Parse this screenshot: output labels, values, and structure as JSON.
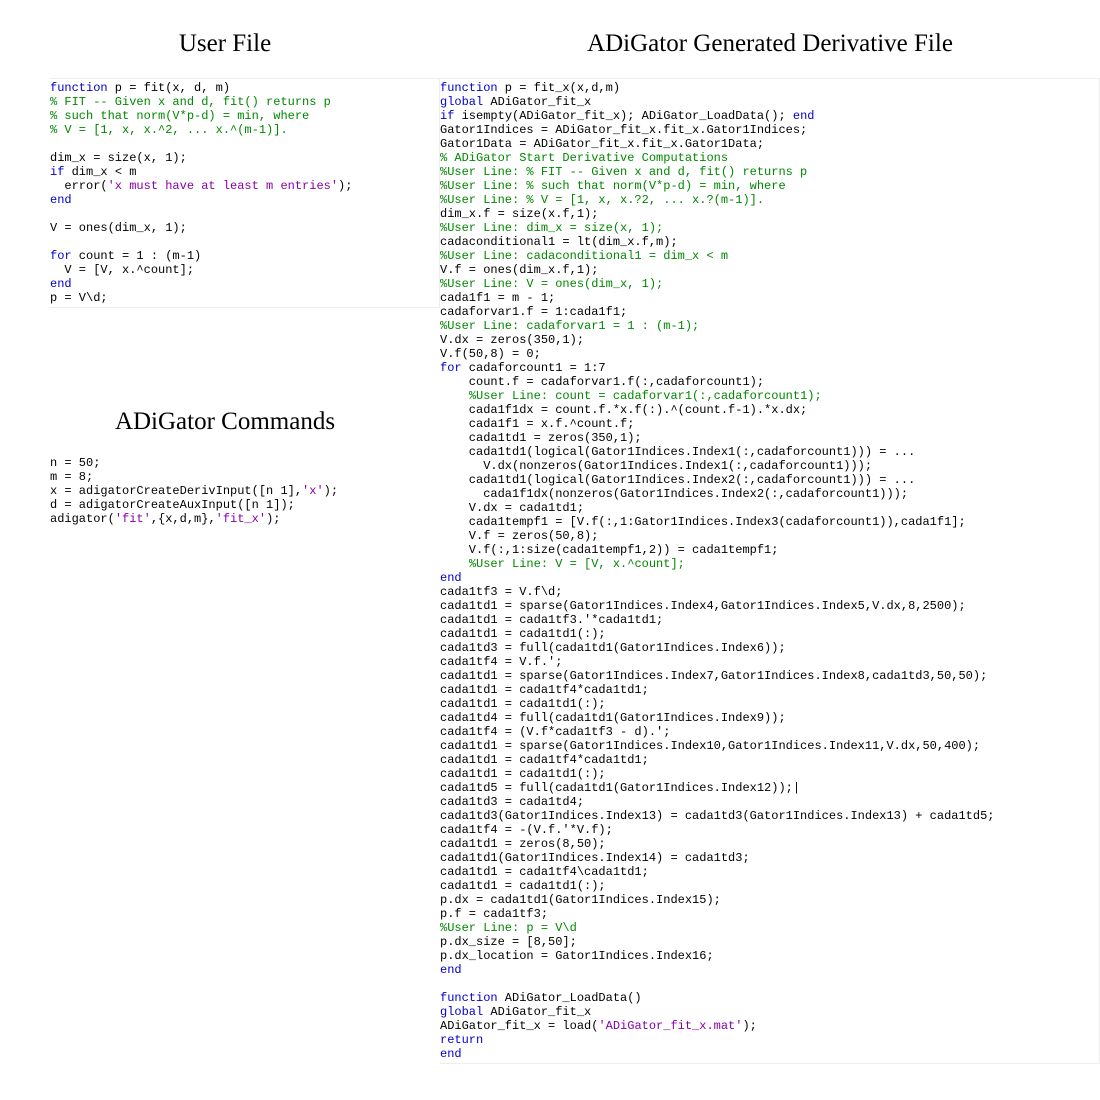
{
  "left": {
    "heading1": "User File",
    "heading2": "ADiGator Commands",
    "userFile": [
      {
        "cls": "kw",
        "t": "function",
        "post": " p = fit(x, d, m)"
      },
      {
        "cls": "cm",
        "t": "% FIT -- Given x and d, fit() returns p"
      },
      {
        "cls": "cm",
        "t": "% such that norm(V*p-d) = min, where"
      },
      {
        "cls": "cm",
        "t": "% V = [1, x, x.^2, ... x.^(m-1)]."
      },
      {
        "cls": "",
        "t": ""
      },
      {
        "cls": "",
        "t": "dim_x = size(x, 1);"
      },
      {
        "cls": "",
        "t": "",
        "pre": "kw:if",
        "mid": " dim_x < m"
      },
      {
        "cls": "",
        "t": "  error(",
        "str": "'x must have at least m entries'",
        "post2": ");"
      },
      {
        "cls": "kw",
        "t": "end"
      },
      {
        "cls": "",
        "t": ""
      },
      {
        "cls": "",
        "t": "V = ones(dim_x, 1);"
      },
      {
        "cls": "",
        "t": ""
      },
      {
        "cls": "",
        "t": "",
        "pre": "kw:for",
        "mid": " count = 1 : (m-1)"
      },
      {
        "cls": "",
        "t": "  V = [V, x.^count];"
      },
      {
        "cls": "kw",
        "t": "end"
      },
      {
        "cls": "",
        "t": "p = V\\d;"
      }
    ],
    "commands": [
      {
        "t": "n = 50;"
      },
      {
        "t": "m = 8;"
      },
      {
        "t": "x = adigatorCreateDerivInput([n 1],",
        "str": "'x'",
        "post": ");"
      },
      {
        "t": "d = adigatorCreateAuxInput([n 1]);"
      },
      {
        "t": "adigator(",
        "str": "'fit'",
        "mid": ",{x,d,m},",
        "str2": "'fit_x'",
        "post": ");"
      }
    ]
  },
  "right": {
    "heading": "ADiGator Generated Derivative File",
    "genFile": [
      {
        "seg": [
          [
            "kw",
            "function"
          ],
          [
            "",
            " p = fit_x(x,d,m)"
          ]
        ]
      },
      {
        "seg": [
          [
            "kw",
            "global"
          ],
          [
            "",
            " ADiGator_fit_x"
          ]
        ]
      },
      {
        "seg": [
          [
            "kw",
            "if"
          ],
          [
            "",
            " isempty(ADiGator_fit_x); ADiGator_LoadData(); "
          ],
          [
            "kw",
            "end"
          ]
        ]
      },
      {
        "seg": [
          [
            "",
            "Gator1Indices = ADiGator_fit_x.fit_x.Gator1Indices;"
          ]
        ]
      },
      {
        "seg": [
          [
            "",
            "Gator1Data = ADiGator_fit_x.fit_x.Gator1Data;"
          ]
        ]
      },
      {
        "seg": [
          [
            "cm",
            "% ADiGator Start Derivative Computations"
          ]
        ]
      },
      {
        "seg": [
          [
            "cm",
            "%User Line: % FIT -- Given x and d, fit() returns p"
          ]
        ]
      },
      {
        "seg": [
          [
            "cm",
            "%User Line: % such that norm(V*p-d) = min, where"
          ]
        ]
      },
      {
        "seg": [
          [
            "cm",
            "%User Line: % V = [1, x, x.?2, ... x.?(m-1)]."
          ]
        ]
      },
      {
        "seg": [
          [
            "",
            "dim_x.f = size(x.f,1);"
          ]
        ]
      },
      {
        "seg": [
          [
            "cm",
            "%User Line: dim_x = size(x, 1);"
          ]
        ]
      },
      {
        "seg": [
          [
            "",
            "cadaconditional1 = lt(dim_x.f,m);"
          ]
        ]
      },
      {
        "seg": [
          [
            "cm",
            "%User Line: cadaconditional1 = dim_x < m"
          ]
        ]
      },
      {
        "seg": [
          [
            "",
            "V.f = ones(dim_x.f,1);"
          ]
        ]
      },
      {
        "seg": [
          [
            "cm",
            "%User Line: V = ones(dim_x, 1);"
          ]
        ]
      },
      {
        "seg": [
          [
            "",
            "cada1f1 = m - 1;"
          ]
        ]
      },
      {
        "seg": [
          [
            "",
            "cadaforvar1.f = 1:cada1f1;"
          ]
        ]
      },
      {
        "seg": [
          [
            "cm",
            "%User Line: cadaforvar1 = 1 : (m-1);"
          ]
        ]
      },
      {
        "seg": [
          [
            "",
            "V.dx = zeros(350,1);"
          ]
        ]
      },
      {
        "seg": [
          [
            "",
            "V.f(50,8) = 0;"
          ]
        ]
      },
      {
        "seg": [
          [
            "kw",
            "for"
          ],
          [
            "",
            " cadaforcount1 = 1:7"
          ]
        ]
      },
      {
        "seg": [
          [
            "",
            "    count.f = cadaforvar1.f(:,cadaforcount1);"
          ]
        ]
      },
      {
        "seg": [
          [
            "",
            "    "
          ],
          [
            "cm",
            "%User Line: count = cadaforvar1(:,cadaforcount1);"
          ]
        ]
      },
      {
        "seg": [
          [
            "",
            "    cada1f1dx = count.f.*x.f(:).^(count.f-1).*x.dx;"
          ]
        ]
      },
      {
        "seg": [
          [
            "",
            "    cada1f1 = x.f.^count.f;"
          ]
        ]
      },
      {
        "seg": [
          [
            "",
            "    cada1td1 = zeros(350,1);"
          ]
        ]
      },
      {
        "seg": [
          [
            "",
            "    cada1td1(logical(Gator1Indices.Index1(:,cadaforcount1))) = ..."
          ]
        ]
      },
      {
        "seg": [
          [
            "",
            "      V.dx(nonzeros(Gator1Indices.Index1(:,cadaforcount1)));"
          ]
        ]
      },
      {
        "seg": [
          [
            "",
            "    cada1td1(logical(Gator1Indices.Index2(:,cadaforcount1))) = ..."
          ]
        ]
      },
      {
        "seg": [
          [
            "",
            "      cada1f1dx(nonzeros(Gator1Indices.Index2(:,cadaforcount1)));"
          ]
        ]
      },
      {
        "seg": [
          [
            "",
            "    V.dx = cada1td1;"
          ]
        ]
      },
      {
        "seg": [
          [
            "",
            "    cada1tempf1 = [V.f(:,1:Gator1Indices.Index3(cadaforcount1)),cada1f1];"
          ]
        ]
      },
      {
        "seg": [
          [
            "",
            "    V.f = zeros(50,8);"
          ]
        ]
      },
      {
        "seg": [
          [
            "",
            "    V.f(:,1:size(cada1tempf1,2)) = cada1tempf1;"
          ]
        ]
      },
      {
        "seg": [
          [
            "",
            "    "
          ],
          [
            "cm",
            "%User Line: V = [V, x.^count];"
          ]
        ]
      },
      {
        "seg": [
          [
            "kw",
            "end"
          ]
        ]
      },
      {
        "seg": [
          [
            "",
            "cada1tf3 = V.f\\d;"
          ]
        ]
      },
      {
        "seg": [
          [
            "",
            "cada1td1 = sparse(Gator1Indices.Index4,Gator1Indices.Index5,V.dx,8,2500);"
          ]
        ]
      },
      {
        "seg": [
          [
            "",
            "cada1td1 = cada1tf3.'*cada1td1;"
          ]
        ]
      },
      {
        "seg": [
          [
            "",
            "cada1td1 = cada1td1(:);"
          ]
        ]
      },
      {
        "seg": [
          [
            "",
            "cada1td3 = full(cada1td1(Gator1Indices.Index6));"
          ]
        ]
      },
      {
        "seg": [
          [
            "",
            "cada1tf4 = V.f.';"
          ]
        ]
      },
      {
        "seg": [
          [
            "",
            "cada1td1 = sparse(Gator1Indices.Index7,Gator1Indices.Index8,cada1td3,50,50);"
          ]
        ]
      },
      {
        "seg": [
          [
            "",
            "cada1td1 = cada1tf4*cada1td1;"
          ]
        ]
      },
      {
        "seg": [
          [
            "",
            "cada1td1 = cada1td1(:);"
          ]
        ]
      },
      {
        "seg": [
          [
            "",
            "cada1td4 = full(cada1td1(Gator1Indices.Index9));"
          ]
        ]
      },
      {
        "seg": [
          [
            "",
            "cada1tf4 = (V.f*cada1tf3 - d).';"
          ]
        ]
      },
      {
        "seg": [
          [
            "",
            "cada1td1 = sparse(Gator1Indices.Index10,Gator1Indices.Index11,V.dx,50,400);"
          ]
        ]
      },
      {
        "seg": [
          [
            "",
            "cada1td1 = cada1tf4*cada1td1;"
          ]
        ]
      },
      {
        "seg": [
          [
            "",
            "cada1td1 = cada1td1(:);"
          ]
        ]
      },
      {
        "seg": [
          [
            "",
            "cada1td5 = full(cada1td1(Gator1Indices.Index12));|"
          ]
        ]
      },
      {
        "seg": [
          [
            "",
            "cada1td3 = cada1td4;"
          ]
        ]
      },
      {
        "seg": [
          [
            "",
            "cada1td3(Gator1Indices.Index13) = cada1td3(Gator1Indices.Index13) + cada1td5;"
          ]
        ]
      },
      {
        "seg": [
          [
            "",
            "cada1tf4 = -(V.f.'*V.f);"
          ]
        ]
      },
      {
        "seg": [
          [
            "",
            "cada1td1 = zeros(8,50);"
          ]
        ]
      },
      {
        "seg": [
          [
            "",
            "cada1td1(Gator1Indices.Index14) = cada1td3;"
          ]
        ]
      },
      {
        "seg": [
          [
            "",
            "cada1td1 = cada1tf4\\cada1td1;"
          ]
        ]
      },
      {
        "seg": [
          [
            "",
            "cada1td1 = cada1td1(:);"
          ]
        ]
      },
      {
        "seg": [
          [
            "",
            "p.dx = cada1td1(Gator1Indices.Index15);"
          ]
        ]
      },
      {
        "seg": [
          [
            "",
            "p.f = cada1tf3;"
          ]
        ]
      },
      {
        "seg": [
          [
            "cm",
            "%User Line: p = V\\d"
          ]
        ]
      },
      {
        "seg": [
          [
            "",
            "p.dx_size = [8,50];"
          ]
        ]
      },
      {
        "seg": [
          [
            "",
            "p.dx_location = Gator1Indices.Index16;"
          ]
        ]
      },
      {
        "seg": [
          [
            "kw",
            "end"
          ]
        ]
      },
      {
        "seg": [
          [
            "",
            ""
          ]
        ]
      },
      {
        "seg": [
          [
            "kw",
            "function"
          ],
          [
            "",
            " ADiGator_LoadData()"
          ]
        ]
      },
      {
        "seg": [
          [
            "kw",
            "global"
          ],
          [
            "",
            " ADiGator_fit_x"
          ]
        ]
      },
      {
        "seg": [
          [
            "",
            "ADiGator_fit_x = load("
          ],
          [
            "str",
            "'ADiGator_fit_x.mat'"
          ],
          [
            "",
            ");"
          ]
        ]
      },
      {
        "seg": [
          [
            "kw",
            "return"
          ]
        ]
      },
      {
        "seg": [
          [
            "kw",
            "end"
          ]
        ]
      }
    ]
  }
}
